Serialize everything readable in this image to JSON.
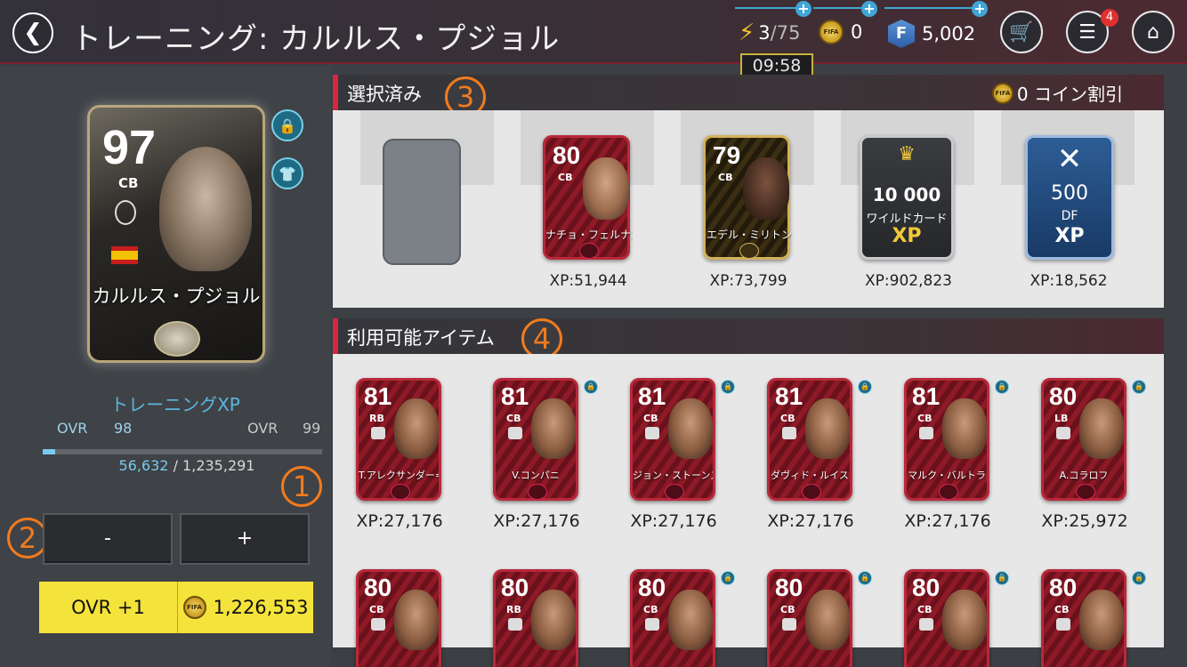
{
  "header": {
    "title": "トレーニング: カルルス・プジョル",
    "back_icon": "arrow-left-icon"
  },
  "currency": {
    "energy": {
      "current": "3",
      "max": "/75"
    },
    "coins": "0",
    "fifa_points": "5,002",
    "fp_symbol": "F",
    "coin_symbol": "FIFA",
    "timer": "09:58",
    "menu_badge": "4"
  },
  "player": {
    "ovr": "97",
    "position": "CB",
    "name": "カルルス・プジョル"
  },
  "training": {
    "label": "トレーニングXP",
    "from_label": "OVR",
    "from_value": "98",
    "to_label": "OVR",
    "to_value": "99",
    "xp_current": "56,632",
    "xp_total": "/ 1,235,291",
    "progress_fraction": 0.046,
    "minus_label": "-",
    "plus_label": "+",
    "ovr_button": "OVR +1",
    "cost": "1,226,553"
  },
  "annotations": {
    "one": "1",
    "two": "2",
    "three": "3",
    "four": "4"
  },
  "selected": {
    "title": "選択済み",
    "discount": "0 コイン割引",
    "items": [
      {
        "ovr": "80",
        "pos": "CB",
        "name": "ナチョ・フェルナンデス",
        "xp": "XP:51,944",
        "style": "red"
      },
      {
        "ovr": "79",
        "pos": "CB",
        "name": "エデル・ミリトン",
        "xp": "XP:73,799",
        "style": "gold"
      },
      {
        "label_top": "10 000",
        "label_mid": "ワイルドカード",
        "label_bottom": "XP",
        "xp": "XP:902,823",
        "style": "wild"
      },
      {
        "label_top": "500",
        "label_mid": "DF",
        "label_bottom": "XP",
        "xp": "XP:18,562",
        "style": "blue"
      }
    ]
  },
  "available": {
    "title": "利用可能アイテム",
    "row1": [
      {
        "ovr": "81",
        "pos": "RB",
        "name": "T.アレクサンダー=アーノルド",
        "xp": "XP:27,176"
      },
      {
        "ovr": "81",
        "pos": "CB",
        "name": "V.コンパニ",
        "xp": "XP:27,176"
      },
      {
        "ovr": "81",
        "pos": "CB",
        "name": "ジョン・ストーンズ",
        "xp": "XP:27,176"
      },
      {
        "ovr": "81",
        "pos": "CB",
        "name": "ダヴィド・ルイス",
        "xp": "XP:27,176"
      },
      {
        "ovr": "81",
        "pos": "CB",
        "name": "マルク・バルトラ",
        "xp": "XP:27,176"
      },
      {
        "ovr": "80",
        "pos": "LB",
        "name": "A.コラロフ",
        "xp": "XP:25,972"
      }
    ],
    "row2": [
      {
        "ovr": "80",
        "pos": "CB"
      },
      {
        "ovr": "80",
        "pos": "RB"
      },
      {
        "ovr": "80",
        "pos": "CB"
      },
      {
        "ovr": "80",
        "pos": "CB"
      },
      {
        "ovr": "80",
        "pos": "CB"
      },
      {
        "ovr": "80",
        "pos": "CB"
      }
    ]
  },
  "colors": {
    "accent_red": "#d7263d",
    "bar_blue": "#7ac9ee",
    "button_yellow": "#f4e33a",
    "annotation_orange": "#f07b1e"
  }
}
